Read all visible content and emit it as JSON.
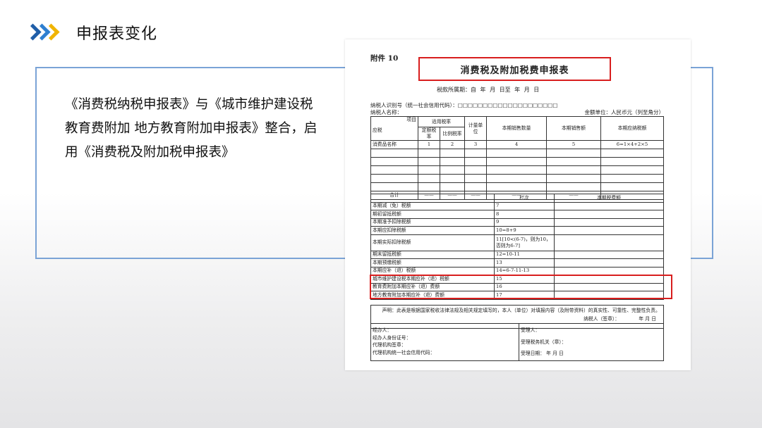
{
  "header": {
    "title": "申报表变化"
  },
  "description": "《消费税纳税申报表》与《城市维护建设税 教育费附加 地方教育附加申报表》整合，启用《消费税及附加税申报表》",
  "document": {
    "attachment": "附件 10",
    "title": "消费税及附加税费申报表",
    "period": "税款所属期：自 年 月 日至 年 月 日",
    "taxpayer_id": "纳税人识别号（统一社会信用代码）：□□□□□□□□□□□□□□□□□□□□",
    "taxpayer_name": "纳税人名称：",
    "amount_unit": "金额单位：人民币元（列至角分）",
    "table1": {
      "item": "项目",
      "taxable": "应税",
      "product_name": "消费品名称",
      "applicable_rate": "适用税率",
      "fixed_rate": "定额税率",
      "ad_valorem_rate": "比例税率",
      "unit": "计量单位",
      "qty": "本期销售数量",
      "sales": "本期销售额",
      "payable": "本期应纳税额",
      "nums": [
        "1",
        "2",
        "3",
        "4",
        "5",
        "6=1×4+2×5"
      ],
      "total": "合计",
      "dash": "——"
    },
    "table2": {
      "col_line": "栏次",
      "col_amount": "本期税费额",
      "rows": [
        {
          "label": "本期减（免）税额",
          "line": "7"
        },
        {
          "label": "期初留抵税额",
          "line": "8"
        },
        {
          "label": "本期准予扣除税额",
          "line": "9"
        },
        {
          "label": "本期应扣除税额",
          "line": "10=8+9"
        },
        {
          "label": "本期实际扣除税额",
          "line": "11[10<(6-7)，则为10，否则为6-7]"
        },
        {
          "label": "期末留抵税额",
          "line": "12=10-11"
        },
        {
          "label": "本期预缴税额",
          "line": "13"
        },
        {
          "label": "本期应补（退）税额",
          "line": "14=6-7-11-13"
        },
        {
          "label": "城市维护建设税本期应补（退）税额",
          "line": "15"
        },
        {
          "label": "教育费附加本期应补（退）费额",
          "line": "16"
        },
        {
          "label": "地方教育附加本期应补（退）费额",
          "line": "17"
        }
      ]
    },
    "declaration": "声明：此表是根据国家税收法律法规及相关规定填写的，本人（单位）对填报内容（及附带资料）的真实性、可靠性、完整性负责。",
    "sign": "纳税人（签章）：",
    "sign_date": "年 月 日",
    "handler": "经办人：",
    "handler_id": "经办人身份证号：",
    "agency_seal": "代理机构签章：",
    "agency_code": "代理机构统一社会信用代码：",
    "receiver": "受理人：",
    "tax_office": "受理税务机关（章）：",
    "receive_date": "受理日期： 年 月 日"
  },
  "colors": {
    "accent": "#1f5ea8",
    "highlight": "#d81e1e",
    "frame": "#7aa3d6"
  }
}
